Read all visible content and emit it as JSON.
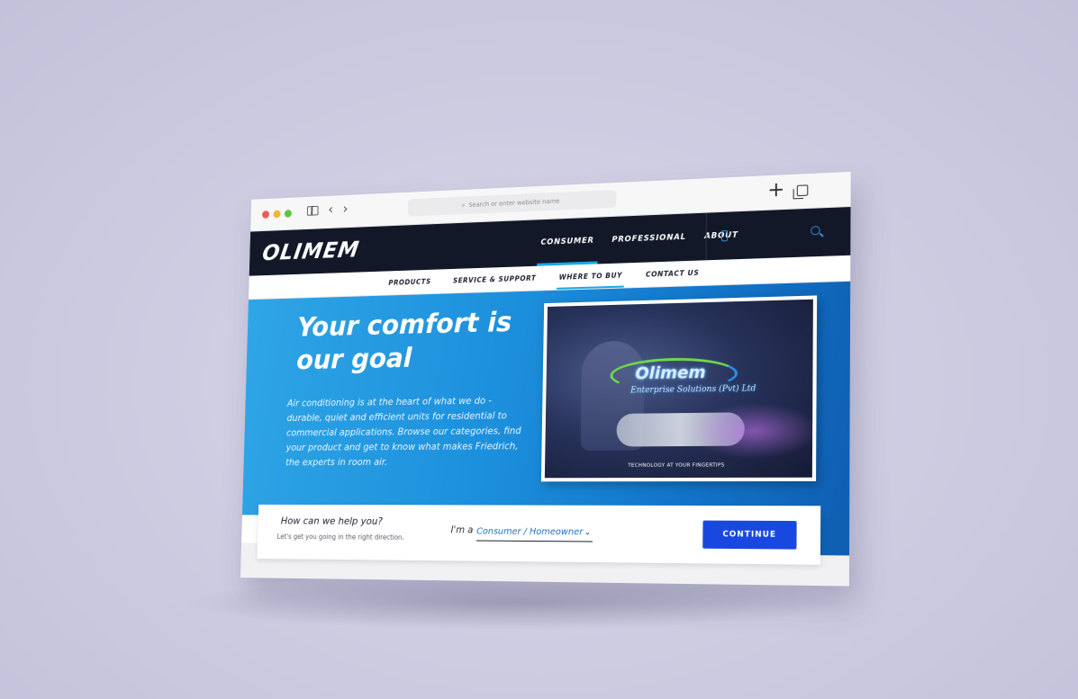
{
  "browser": {
    "address_placeholder": "Search or enter website name",
    "icons": [
      "sidebar-icon",
      "back-icon",
      "forward-icon",
      "new-tab-icon",
      "tabs-overview-icon"
    ],
    "back_glyph": "‹",
    "forward_glyph": "›",
    "plus_glyph": "+"
  },
  "site": {
    "logo": "OLIMEM",
    "topnav": [
      "CONSUMER",
      "PROFESSIONAL",
      "ABOUT"
    ],
    "active_topnav": "CONSUMER",
    "subnav": [
      "PRODUCTS",
      "SERVICE & SUPPORT",
      "WHERE TO BUY",
      "CONTACT US"
    ],
    "active_subnav": "WHERE TO BUY"
  },
  "hero": {
    "title": "Your comfort is our goal",
    "text": "Air conditioning is at the heart of what we do - durable, quiet and efficient units for residential to commercial applications. Browse our categories, find your product and get to know what makes Friedrich, the experts in room air.",
    "image": {
      "logo_text": "Olimem",
      "sub_text": "Enterprise Solutions (Pvt) Ltd",
      "caption": "TECHNOLOGY AT YOUR FINGERTIPS"
    }
  },
  "help": {
    "title": "How can we help you?",
    "subtitle": "Let's get you going in the right direction.",
    "im_label": "I'm a",
    "selected_role": "Consumer / Homeowner",
    "continue_label": "CONTINUE"
  },
  "colors": {
    "header_bg": "#121828",
    "accent": "#1aa8e8",
    "hero_blue": "#1c8fdc",
    "button_blue": "#1848e0"
  }
}
